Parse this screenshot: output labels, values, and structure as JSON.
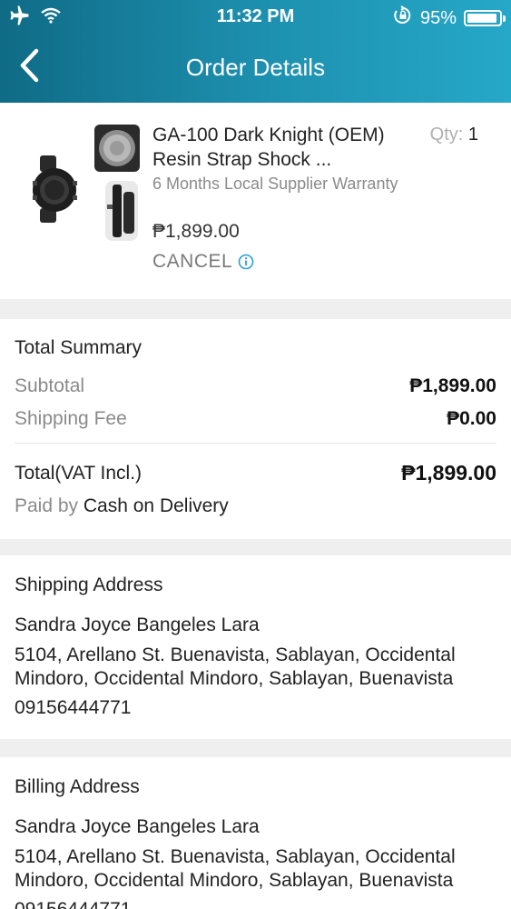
{
  "status_bar": {
    "time": "11:32 PM",
    "battery_text": "95%",
    "battery_level": 0.95,
    "icons": [
      "airplane-icon",
      "wifi-icon",
      "rotation-lock-icon",
      "battery-icon"
    ]
  },
  "header": {
    "title": "Order Details",
    "back_icon": "chevron-left-icon",
    "gradient": [
      "#0f6b86",
      "#26a8c8"
    ]
  },
  "product": {
    "name": "GA-100 Dark Knight (OEM) Resin Strap Shock ...",
    "qty_label": "Qty:",
    "qty_value": "1",
    "warranty": "6 Months Local Supplier Warranty",
    "price": "₱1,899.00",
    "cancel_label": "CANCEL",
    "info_icon": "info-icon"
  },
  "summary": {
    "title": "Total Summary",
    "subtotal_label": "Subtotal",
    "subtotal_value": "₱1,899.00",
    "shipping_label": "Shipping Fee",
    "shipping_value": "₱0.00",
    "total_label": "Total(VAT Incl.)",
    "total_value": "₱1,899.00",
    "paid_label": "Paid by",
    "paid_value": "Cash on Delivery"
  },
  "shipping_address": {
    "title": "Shipping Address",
    "name": "Sandra Joyce Bangeles Lara",
    "address": "5104, Arellano St. Buenavista, Sablayan, Occidental Mindoro, Occidental Mindoro, Sablayan, Buenavista",
    "phone": "09156444771"
  },
  "billing_address": {
    "title": "Billing Address",
    "name": "Sandra Joyce Bangeles Lara",
    "address": "5104, Arellano St. Buenavista, Sablayan, Occidental Mindoro, Occidental Mindoro, Sablayan, Buenavista",
    "phone": "09156444771"
  },
  "colors": {
    "accent": "#1d8fae",
    "info_icon": "#2a9fd6",
    "muted_text": "#8a8a8a",
    "divider": "#efefef"
  }
}
